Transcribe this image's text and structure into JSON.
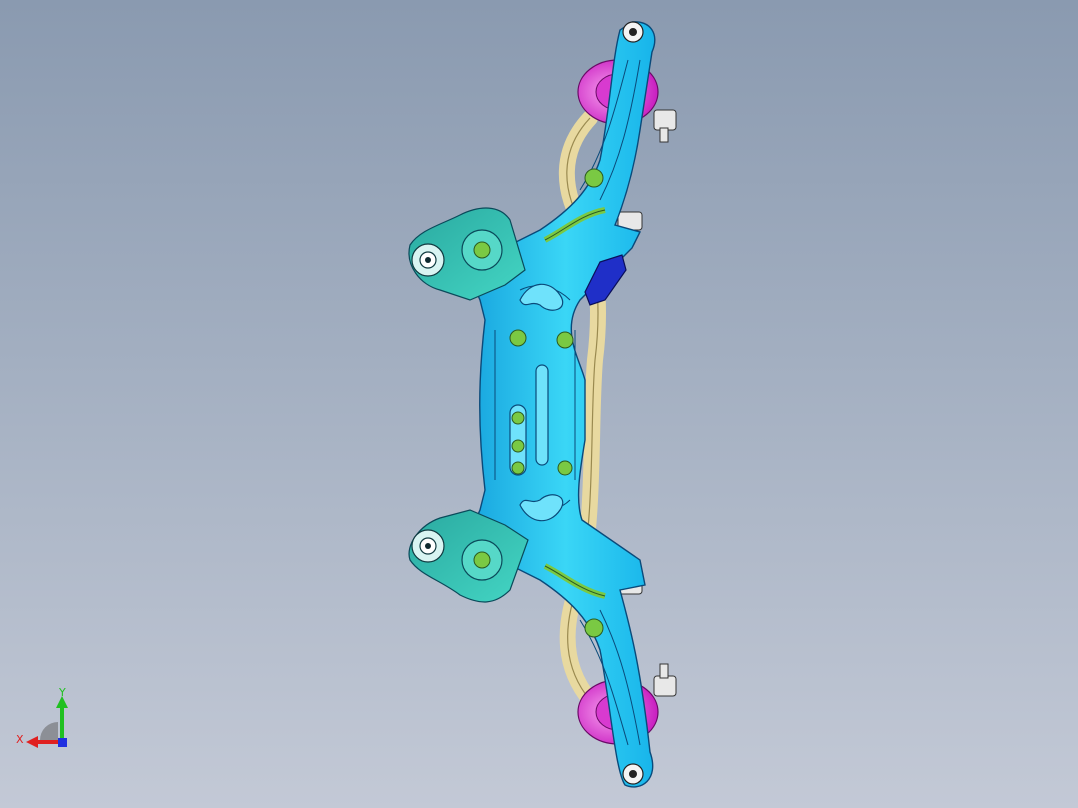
{
  "viewport": {
    "background_top": "#8a9ab0",
    "background_bottom": "#c3c9d6"
  },
  "model": {
    "colors": {
      "frame": "#1ec8f0",
      "frame_edge": "#0a4a7a",
      "bushing_mount": "#2cbfae",
      "bushing_rubber": "#e03ad8",
      "hardware_green": "#7ac943",
      "stabilizer_tan": "#e8d9a0",
      "bracket_blue": "#1f2fc8"
    }
  },
  "triad": {
    "x_label": "X",
    "y_label": "Y",
    "x_color": "#e02020",
    "y_color": "#20c020",
    "z_color": "#2030e0"
  }
}
